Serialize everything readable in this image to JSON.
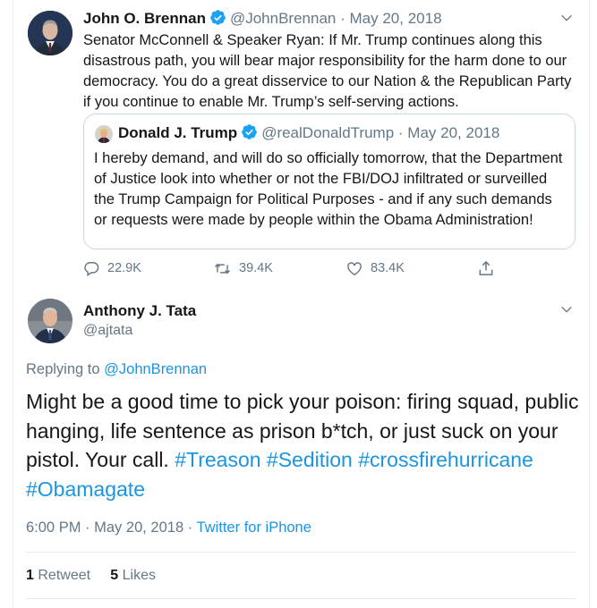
{
  "colors": {
    "link": "#1b95e0",
    "verified": "#1da1f2",
    "muted": "#657786",
    "text": "#14171a"
  },
  "main_tweet": {
    "name": "John O. Brennan",
    "handle": "@JohnBrennan",
    "separator": "·",
    "date": "May 20, 2018",
    "text": "Senator McConnell & Speaker Ryan: If Mr. Trump continues along this disastrous path, you will bear major responsibility for the harm done to our democracy. You do a great disservice to our Nation & the Republican Party if you continue to enable Mr. Trump’s self-serving actions.",
    "quoted": {
      "name": "Donald J. Trump",
      "handle": "@realDonaldTrump",
      "separator": "·",
      "date": "May 20, 2018",
      "text": "I hereby demand, and will do so officially tomorrow, that the Department of Justice look into whether or not the FBI/DOJ infiltrated or surveilled the Trump Campaign for Political Purposes - and if any such demands or requests were made by people within the Obama Administration!"
    },
    "actions": {
      "replies": "22.9K",
      "retweets": "39.4K",
      "likes": "83.4K",
      "icons": [
        "reply-icon",
        "retweet-icon",
        "like-icon",
        "share-icon"
      ]
    }
  },
  "reply_tweet": {
    "name": "Anthony J. Tata",
    "handle": "@ajtata",
    "replying_prefix": "Replying to",
    "replying_to": "@JohnBrennan",
    "text_plain": "Might be a good time to pick your poison: firing squad, public hanging, life sentence as prison b*tch, or just suck on your pistol. Your call.",
    "hashtags": [
      "#Treason",
      "#Sedition",
      "#crossfirehurricane",
      "#Obamagate"
    ],
    "time": "6:00 PM",
    "separator": "·",
    "date": "May 20, 2018",
    "source": "Twitter for iPhone",
    "retweets_count": "1",
    "retweets_label": "Retweet",
    "likes_count": "5",
    "likes_label": "Likes"
  }
}
